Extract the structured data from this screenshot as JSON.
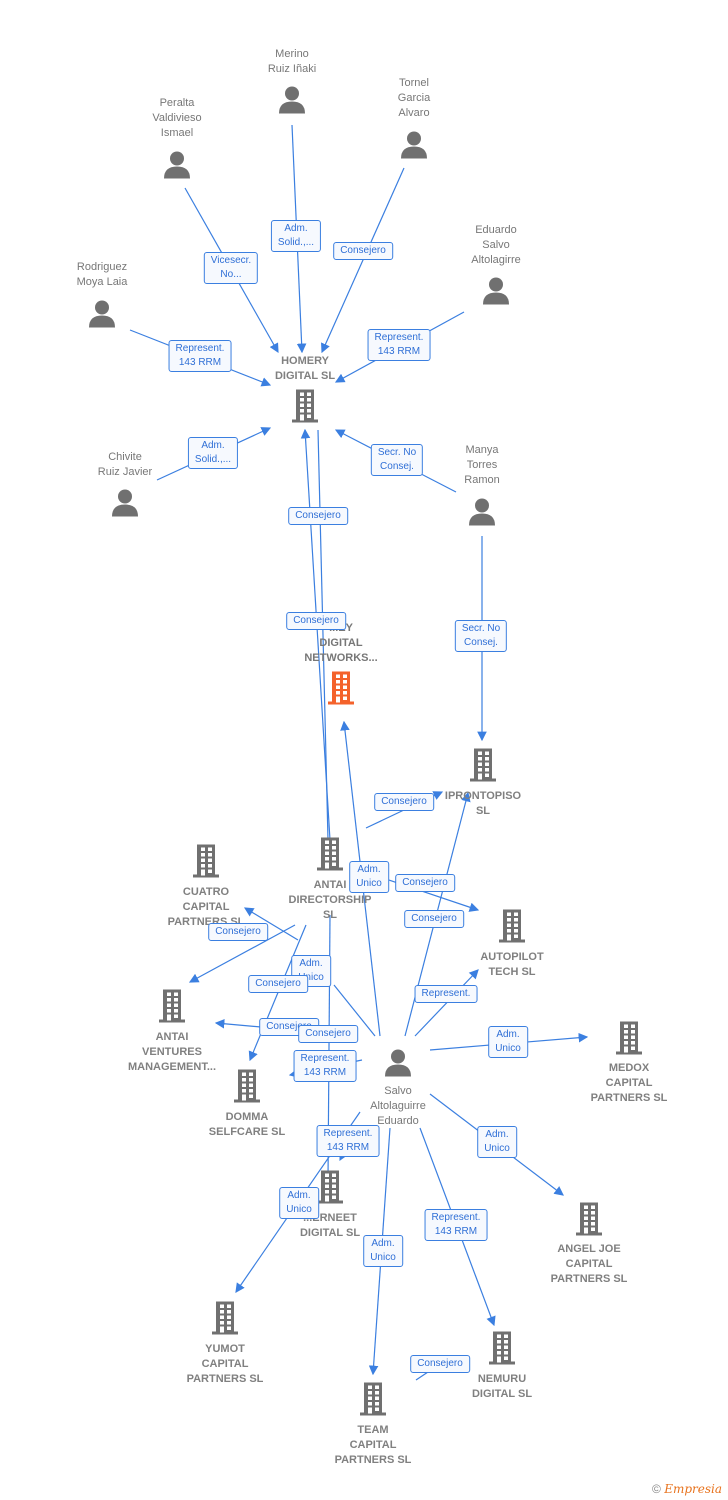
{
  "nodes": [
    {
      "type": "person",
      "label": [
        "Merino",
        "Ruiz Iñaki"
      ]
    },
    {
      "type": "person",
      "label": [
        "Peralta",
        "Valdivieso",
        "Ismael"
      ]
    },
    {
      "type": "person",
      "label": [
        "Tornel",
        "Garcia",
        "Alvaro"
      ]
    },
    {
      "type": "person",
      "label": [
        "Eduardo",
        "Salvo",
        "Altolagirre"
      ]
    },
    {
      "type": "person",
      "label": [
        "Rodriguez",
        "Moya Laia"
      ]
    },
    {
      "type": "person",
      "label": [
        "Chivite",
        "Ruiz Javier"
      ]
    },
    {
      "type": "person",
      "label": [
        "Manya",
        "Torres",
        "Ramon"
      ]
    },
    {
      "type": "person",
      "label": [
        "Salvo",
        "Altolaguirre",
        "Eduardo"
      ]
    },
    {
      "type": "company",
      "label": [
        "HOMERY",
        "DIGITAL  SL"
      ]
    },
    {
      "type": "main",
      "label": [
        "...EY",
        "DIGITAL",
        "NETWORKS..."
      ]
    },
    {
      "type": "company",
      "label": [
        "IPRONTOPISO",
        "SL"
      ]
    },
    {
      "type": "company",
      "label": [
        "ANTAI",
        "DIRECTORSHIP",
        "SL"
      ]
    },
    {
      "type": "company",
      "label": [
        "CUATRO",
        "CAPITAL",
        "PARTNERS  SL"
      ]
    },
    {
      "type": "company",
      "label": [
        "AUTOPILOT",
        "TECH  SL"
      ]
    },
    {
      "type": "company",
      "label": [
        "ANTAI",
        "VENTURES",
        "MANAGEMENT..."
      ]
    },
    {
      "type": "company",
      "label": [
        "MEDOX",
        "CAPITAL",
        "PARTNERS  SL"
      ]
    },
    {
      "type": "company",
      "label": [
        "DOMMA",
        "SELFCARE  SL"
      ]
    },
    {
      "type": "company",
      "label": [
        "...ERNEET",
        "DIGITAL  SL"
      ]
    },
    {
      "type": "company",
      "label": [
        "ANGEL JOE",
        "CAPITAL",
        "PARTNERS  SL"
      ]
    },
    {
      "type": "company",
      "label": [
        "YUMOT",
        "CAPITAL",
        "PARTNERS  SL"
      ]
    },
    {
      "type": "company",
      "label": [
        "NEMURU",
        "DIGITAL  SL"
      ]
    },
    {
      "type": "company",
      "label": [
        "TEAM",
        "CAPITAL",
        "PARTNERS  SL"
      ]
    }
  ],
  "edge_labels": [
    [
      "Adm.",
      "Solid.,..."
    ],
    [
      "Vicesecr.",
      "No..."
    ],
    [
      "Consejero"
    ],
    [
      "Represent.",
      "143 RRM"
    ],
    [
      "Represent.",
      "143 RRM"
    ],
    [
      "Adm.",
      "Solid.,..."
    ],
    [
      "Secr.  No",
      "Consej."
    ],
    [
      "Consejero"
    ],
    [
      "Consejero"
    ],
    [
      "Secr.  No",
      "Consej."
    ],
    [
      "Consejero"
    ],
    [
      "Adm.",
      "Unico"
    ],
    [
      "Consejero"
    ],
    [
      "Consejero"
    ],
    [
      "Consejero"
    ],
    [
      "Adm.",
      "Unico"
    ],
    [
      "Consejero"
    ],
    [
      "Represent."
    ],
    [
      "Consejero"
    ],
    [
      "Consejero"
    ],
    [
      "Adm.",
      "Unico"
    ],
    [
      "Represent.",
      "143 RRM"
    ],
    [
      "Represent.",
      "143 RRM"
    ],
    [
      "Adm.",
      "Unico"
    ],
    [
      "Adm.",
      "Unico"
    ],
    [
      "Represent.",
      "143 RRM"
    ],
    [
      "Adm.",
      "Unico"
    ],
    [
      "Consejero"
    ]
  ],
  "colors": {
    "edge": "#3b7fe0",
    "icon": "#707070",
    "main_icon": "#f4622b",
    "label_text": "#2f6fd6"
  },
  "footer": {
    "copyright": "©",
    "brand": "Empresia"
  }
}
